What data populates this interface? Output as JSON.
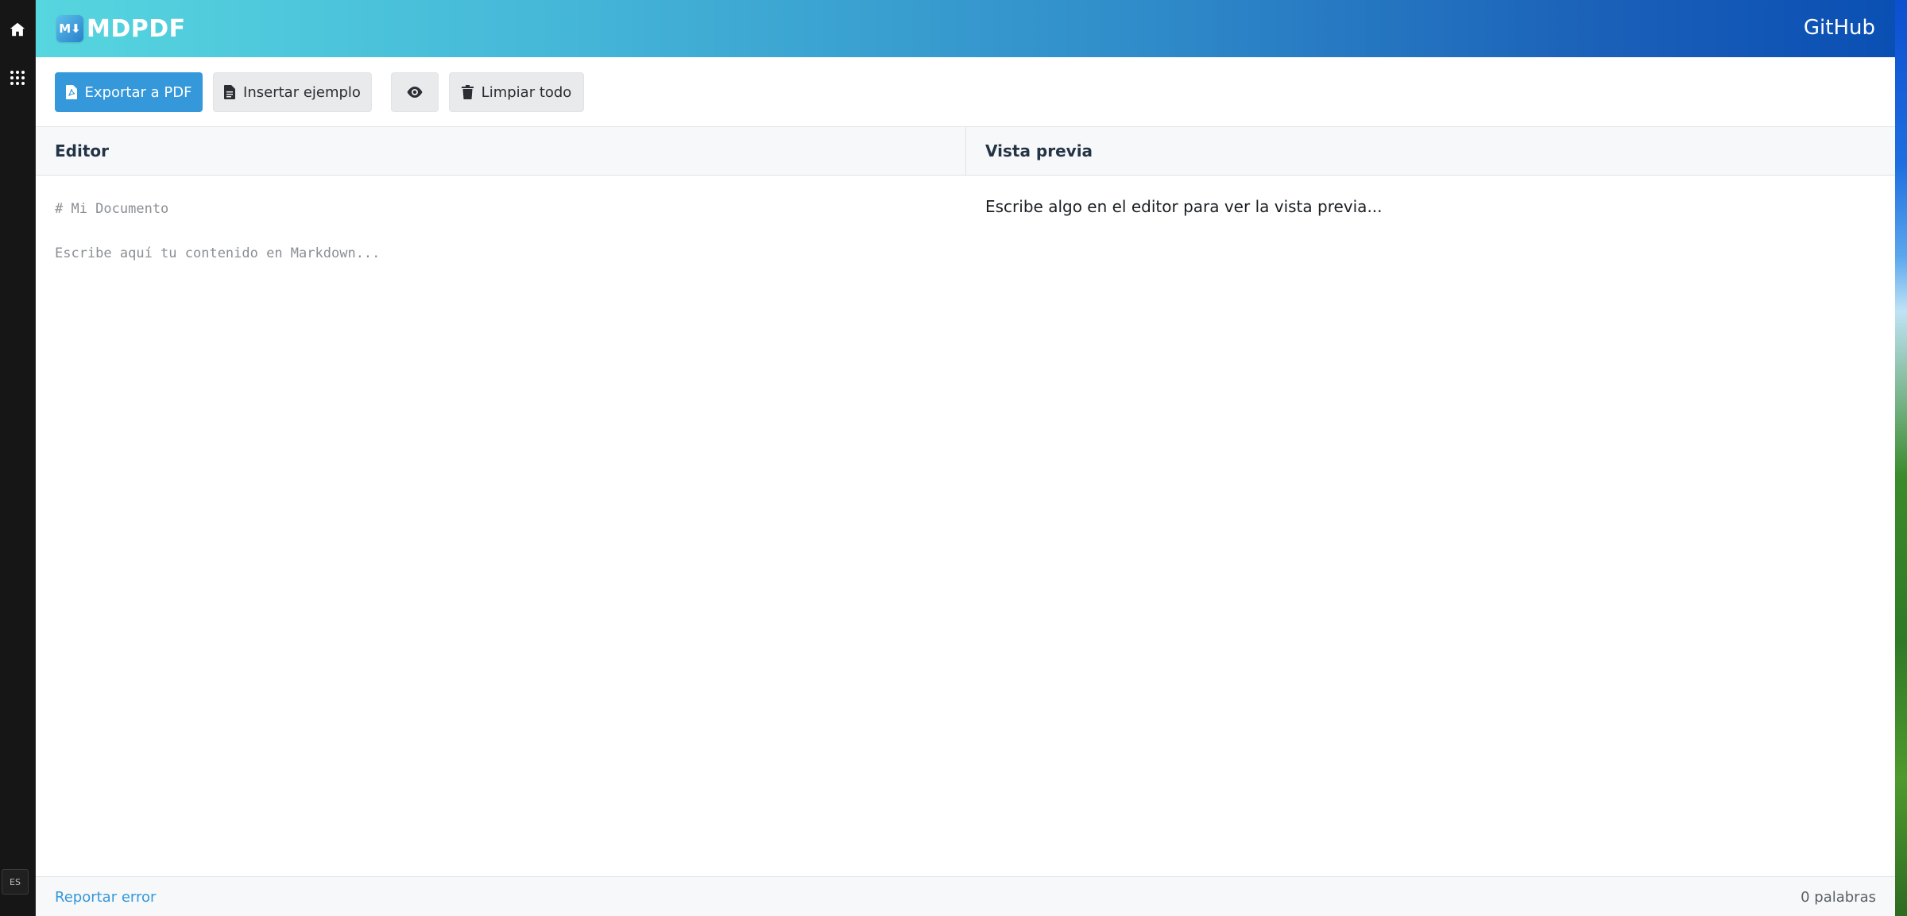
{
  "dock": {
    "language": "ES"
  },
  "app": {
    "brand": {
      "logo_text": "M⬇",
      "name": "MDPDF"
    },
    "nav": {
      "github_label": "GitHub"
    },
    "toolbar": {
      "export_label": "Exportar a PDF",
      "example_label": "Insertar ejemplo",
      "clear_label": "Limpiar todo",
      "preview_icon": "eye-icon"
    },
    "editor": {
      "header": "Editor",
      "value": "",
      "placeholder": "# Mi Documento\n\nEscribe aquí tu contenido en Markdown..."
    },
    "preview": {
      "header": "Vista previa",
      "empty_text": "Escribe algo en el editor para ver la vista previa..."
    },
    "footer": {
      "report_label": "Reportar error",
      "word_count": "0 palabras"
    }
  },
  "colors": {
    "primary": "#3498db",
    "navbar_start": "#56d6df",
    "navbar_end": "#0a4fb3",
    "dock": "#161616"
  }
}
